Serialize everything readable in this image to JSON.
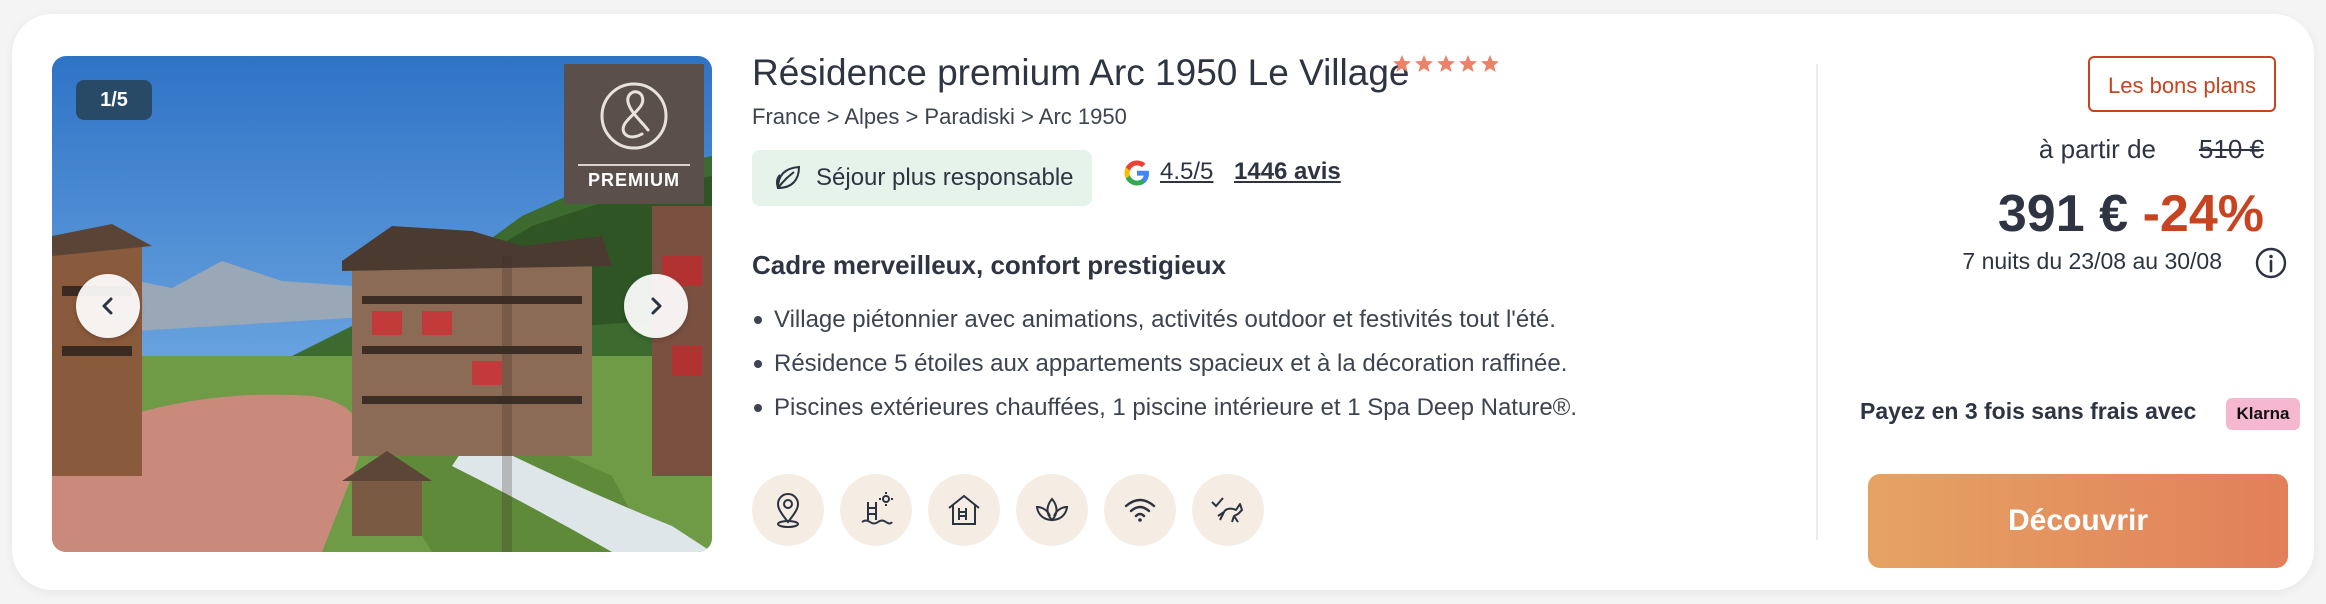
{
  "photo": {
    "counter": "1/5",
    "badge_label": "PREMIUM",
    "prev_icon": "chevron-left-icon",
    "next_icon": "chevron-right-icon"
  },
  "listing": {
    "title": "Résidence premium Arc 1950 Le Village",
    "star_rating": 5,
    "breadcrumb": "France > Alpes > Paradiski > Arc 1950",
    "eco_label": "Séjour plus responsable",
    "google_rating": "4.5/5",
    "reviews": "1446 avis",
    "heading": "Cadre merveilleux, confort prestigieux",
    "bullets": [
      "Village piétonnier avec animations, activités outdoor et festivités tout l'été.",
      "Résidence 5 étoiles aux appartements spacieux et à la décoration raffinée.",
      "Piscines extérieures chauffées, 1 piscine intérieure et 1 Spa Deep Nature®."
    ],
    "amenities": [
      "location-pin-icon",
      "outdoor-pool-icon",
      "indoor-pool-icon",
      "spa-lotus-icon",
      "wifi-icon",
      "pets-allowed-icon"
    ]
  },
  "pricing": {
    "deals_label": "Les bons plans",
    "from_label": "à partir de",
    "old_price": "510 €",
    "price": "391 €",
    "discount": "-24%",
    "dates": "7 nuits du 23/08 au 30/08",
    "pay_label": "Payez en 3 fois sans frais avec",
    "klarna": "Klarna",
    "cta": "Découvrir"
  },
  "colors": {
    "accent": "#c8431f",
    "eco_bg": "#e6f3ea",
    "counter_bg": "#284a66",
    "star": "#e9846b",
    "cta_from": "#e5a363",
    "cta_to": "#e27f5a"
  }
}
